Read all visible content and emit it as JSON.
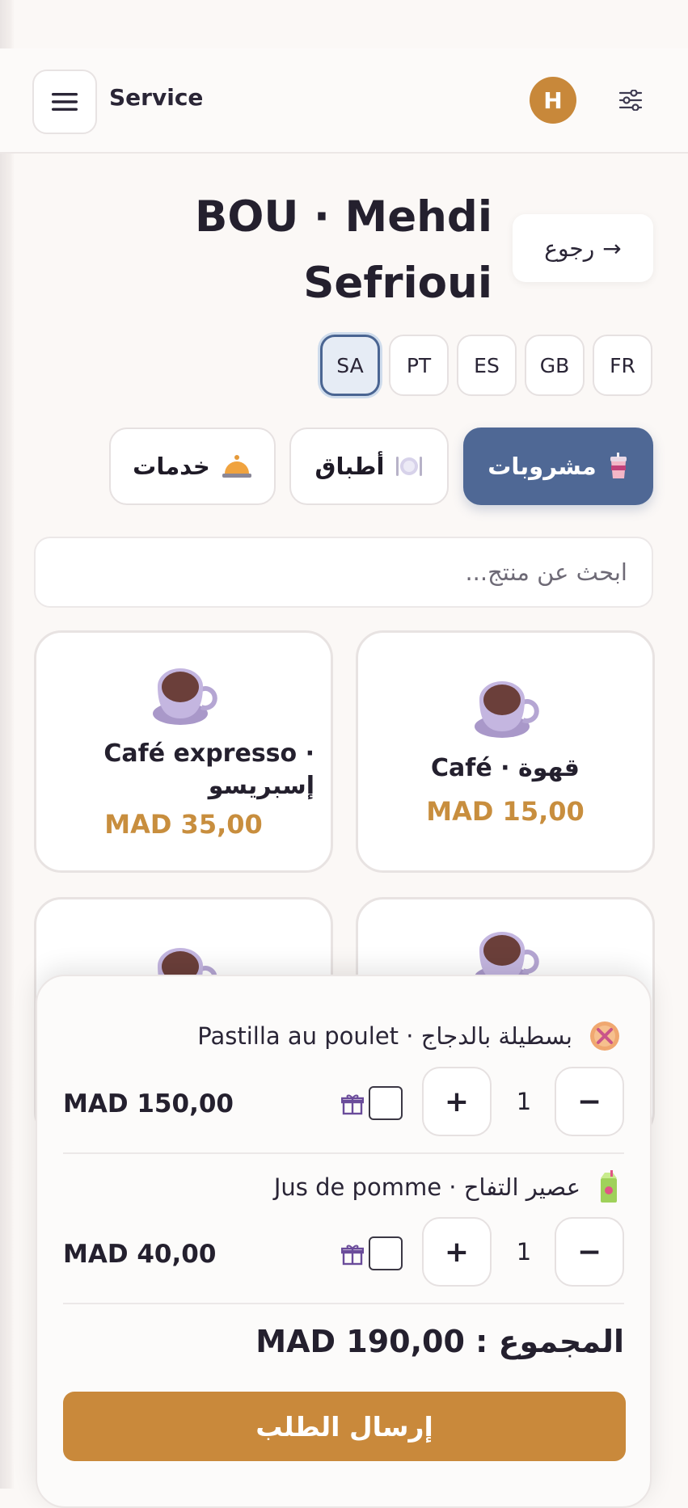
{
  "header": {
    "menu_icon": "hamburger-icon",
    "title": "Service",
    "avatar_initial": "H",
    "settings_icon": "sliders-icon"
  },
  "guest": {
    "title_line1": "BOU · Mehdi",
    "title_line2": "Sefrioui"
  },
  "back": {
    "label": "رجوع",
    "arrow": "→"
  },
  "languages": [
    {
      "code": "SA",
      "active": true
    },
    {
      "code": "PT"
    },
    {
      "code": "ES"
    },
    {
      "code": "GB"
    },
    {
      "code": "FR"
    }
  ],
  "categories": [
    {
      "label": "مشروبات",
      "icon": "drink-cup-icon",
      "active": true
    },
    {
      "label": "أطباق",
      "icon": "plate-icon"
    },
    {
      "label": "خدمات",
      "icon": "service-bell-icon"
    }
  ],
  "search": {
    "placeholder": "ابحث عن منتج..."
  },
  "products": [
    {
      "name": "Café · قهوة",
      "price": "MAD 15,00",
      "icon": "coffee-cup-icon"
    },
    {
      "name_line1": "Café expresso ·",
      "name_line2": "إسبريسو",
      "price": "MAD 35,00",
      "icon": "coffee-cup-icon"
    },
    {
      "icon": "coffee-cup-icon"
    },
    {
      "icon": "coffee-cup-icon"
    }
  ],
  "cart": {
    "items": [
      {
        "name": "Pastilla au poulet · بسطيلة بالدجاج",
        "icon": "pastilla-icon",
        "qty": "1",
        "price": "MAD 150,00",
        "plus": "+",
        "minus": "−"
      },
      {
        "name": "Jus de pomme · عصير التفاح",
        "icon": "juice-box-icon",
        "qty": "1",
        "price": "MAD 40,00",
        "plus": "+",
        "minus": "−"
      }
    ],
    "total_label": "المجموع :",
    "total_value": "MAD 190,00",
    "submit_label": "إرسال الطلب"
  },
  "colors": {
    "accent_gold": "#c9893b",
    "accent_blue": "#4f6895",
    "price_gold": "#c88e3e"
  }
}
